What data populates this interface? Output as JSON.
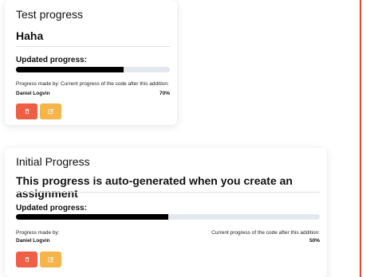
{
  "accent_line_color": "#e8432b",
  "cards": [
    {
      "title": "Test progress",
      "subtitle": "Haha",
      "progress_label": "Updated progress:",
      "progress_value": 0.7,
      "made_by_label": "Progress made by:",
      "current_label": "Current progress of the code after this addition:",
      "author": "Daniel Logvin",
      "percent": "70%",
      "delete_icon": "trash-icon",
      "edit_icon": "edit-icon"
    },
    {
      "title": "Initial Progress",
      "subtitle": "This progress is auto-generated when you create an assignment",
      "progress_label": "Updated progress:",
      "progress_value": 0.5,
      "made_by_label": "Progress made by:",
      "current_label": "Current progress of the code after this addition:",
      "author": "Daniel Logvin",
      "percent": "50%",
      "delete_icon": "trash-icon",
      "edit_icon": "edit-icon"
    }
  ]
}
